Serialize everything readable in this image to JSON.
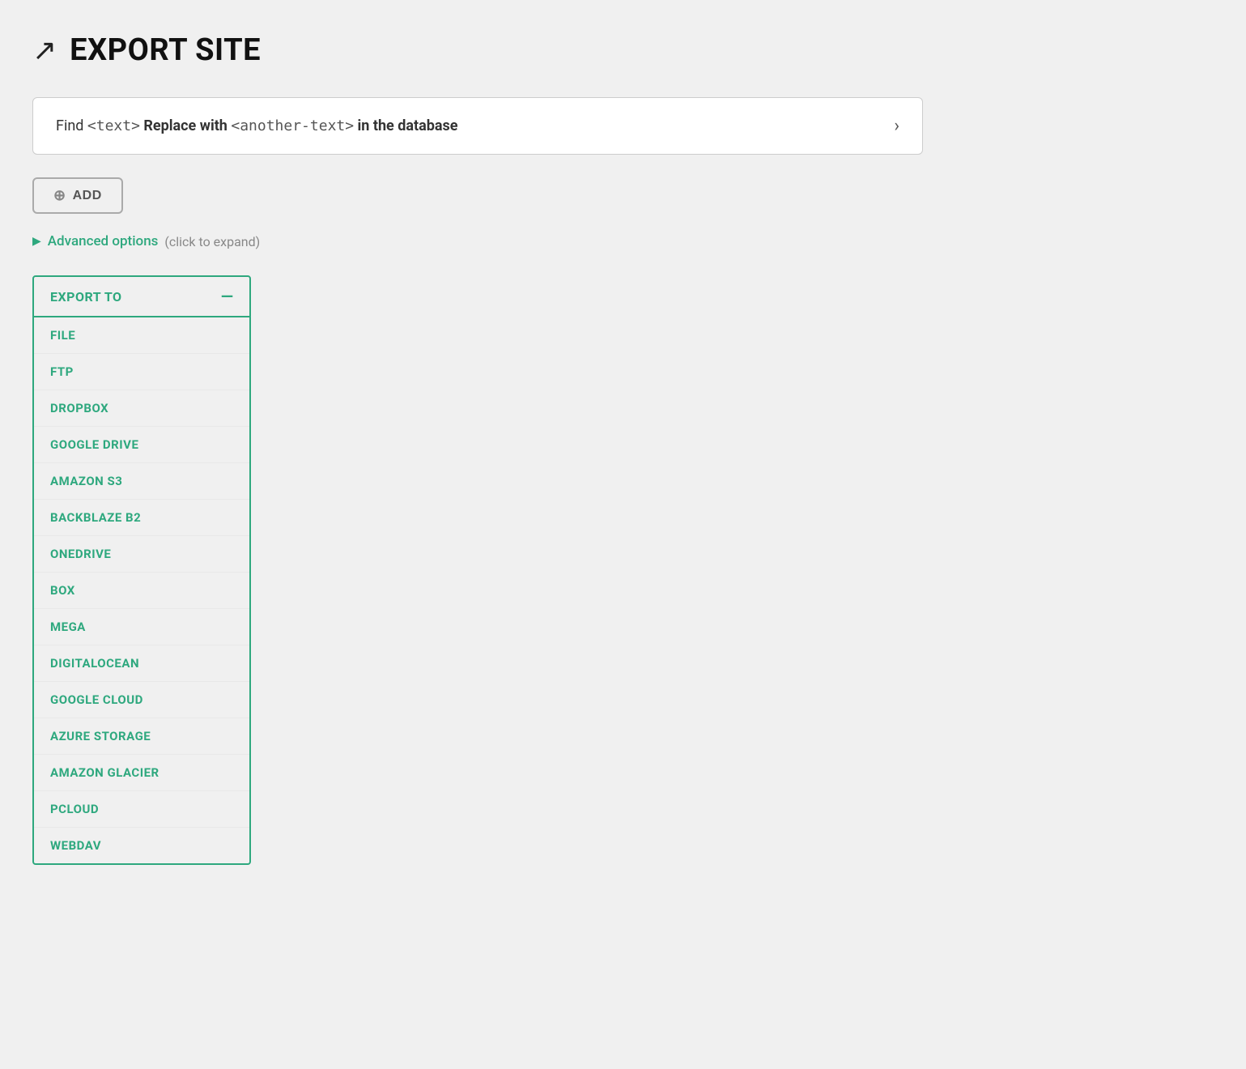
{
  "header": {
    "icon": "↗",
    "title": "EXPORT SITE"
  },
  "findReplace": {
    "prefix": "Find",
    "findTag": "<text>",
    "action": "Replace with",
    "replaceTag": "<another-text>",
    "suffix": "in the database",
    "arrowIcon": "›"
  },
  "addButton": {
    "plusIcon": "⊕",
    "label": "ADD"
  },
  "advancedOptions": {
    "triangleIcon": "▶",
    "label": "Advanced options",
    "hint": "(click to expand)"
  },
  "exportPanel": {
    "header": "EXPORT TO",
    "collapseIcon": "—",
    "items": [
      "FILE",
      "FTP",
      "DROPBOX",
      "GOOGLE DRIVE",
      "AMAZON S3",
      "BACKBLAZE B2",
      "ONEDRIVE",
      "BOX",
      "MEGA",
      "DIGITALOCEAN",
      "GOOGLE CLOUD",
      "AZURE STORAGE",
      "AMAZON GLACIER",
      "PCLOUD",
      "WEBDAV"
    ]
  }
}
